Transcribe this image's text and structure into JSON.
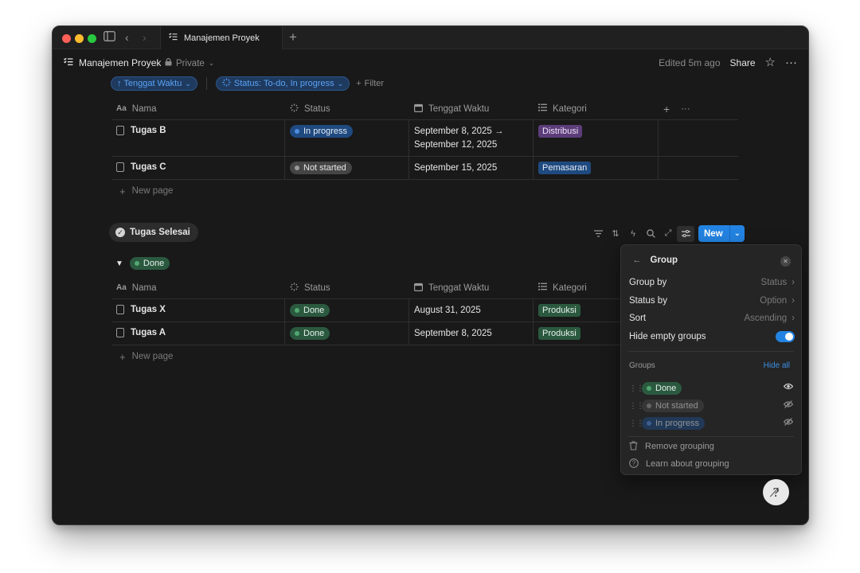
{
  "tab": {
    "title": "Manajemen Proyek"
  },
  "topbar": {
    "title": "Manajemen Proyek",
    "privacy": "Private",
    "edited": "Edited 5m ago",
    "share": "Share"
  },
  "filters": {
    "sort_chip": "↑ Tenggat Waktu",
    "status_chip": "Status: To-do, In progress",
    "add_filter": "Filter"
  },
  "columns": [
    "Nama",
    "Status",
    "Tenggat Waktu",
    "Kategori"
  ],
  "table1": {
    "rows": [
      {
        "name": "Tugas B",
        "status": "In progress",
        "date_line1": "September 8, 2025 →",
        "date_line2": "September 12, 2025",
        "category": "Distribusi"
      },
      {
        "name": "Tugas C",
        "status": "Not started",
        "date_line1": "September 15, 2025",
        "date_line2": "",
        "category": "Pemasaran"
      }
    ],
    "new_page": "New page"
  },
  "section2": {
    "title": "Tugas Selesai",
    "new_button": "New",
    "group_label": "Done"
  },
  "table2": {
    "rows": [
      {
        "name": "Tugas X",
        "status": "Done",
        "date": "August 31, 2025",
        "category": "Produksi"
      },
      {
        "name": "Tugas A",
        "status": "Done",
        "date": "September 8, 2025",
        "category": "Produksi"
      }
    ],
    "new_page": "New page"
  },
  "panel": {
    "title": "Group",
    "group_by_label": "Group by",
    "group_by_value": "Status",
    "status_by_label": "Status by",
    "status_by_value": "Option",
    "sort_label": "Sort",
    "sort_value": "Ascending",
    "hide_empty_label": "Hide empty groups",
    "hide_empty_on": true,
    "groups_label": "Groups",
    "hide_all": "Hide all",
    "groups": [
      {
        "label": "Done",
        "visible": true
      },
      {
        "label": "Not started",
        "visible": false
      },
      {
        "label": "In progress",
        "visible": false
      }
    ],
    "remove_grouping": "Remove grouping",
    "learn_grouping": "Learn about grouping"
  },
  "colors": {
    "accent": "#2383e2",
    "done": "#2b593f",
    "in_progress": "#1f4a80",
    "not_started": "#454545"
  }
}
